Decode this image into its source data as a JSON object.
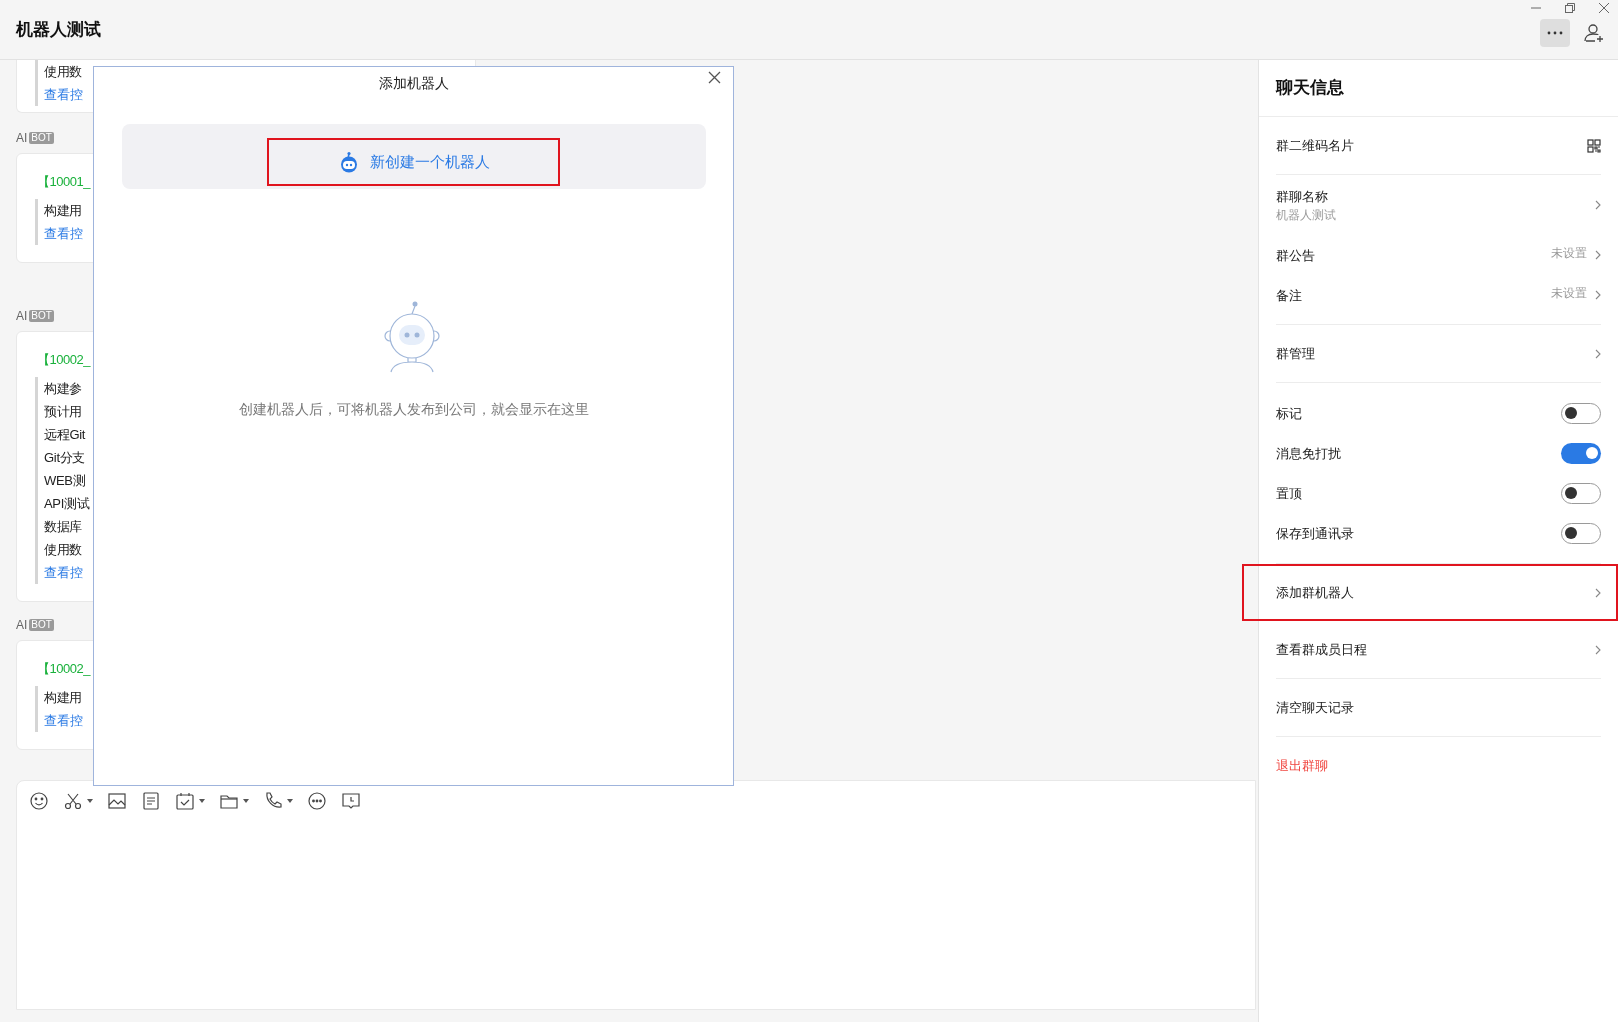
{
  "window": {
    "title": "机器人测试"
  },
  "messages": [
    {
      "lines": [
        "使用数"
      ],
      "link": "查看控"
    },
    {
      "sender": "AI",
      "badge": "BOT",
      "heading": "【10001_",
      "lines": [
        "构建用"
      ],
      "link": "查看控"
    },
    {
      "sender": "AI",
      "badge": "BOT",
      "heading": "【10002_",
      "lines": [
        "构建参",
        "预计用",
        "远程Git",
        "Git分支",
        "WEB测",
        "API测试",
        "数据库",
        "使用数"
      ],
      "link": "查看控"
    },
    {
      "sender": "AI",
      "badge": "BOT",
      "heading": "【10002_",
      "lines": [
        "构建用"
      ],
      "link": "查看控"
    }
  ],
  "toolbar": [
    {
      "kind": "emoji",
      "dropdown": false
    },
    {
      "kind": "scissors",
      "dropdown": true
    },
    {
      "kind": "image",
      "dropdown": false
    },
    {
      "kind": "note",
      "dropdown": false
    },
    {
      "kind": "task",
      "dropdown": true
    },
    {
      "kind": "folder",
      "dropdown": true
    },
    {
      "kind": "phone",
      "dropdown": true
    },
    {
      "kind": "more",
      "dropdown": false
    },
    {
      "kind": "schedule",
      "dropdown": false
    }
  ],
  "dialog": {
    "title": "添加机器人",
    "create_button": {
      "label": "新创建一个机器人",
      "highlighted": true
    },
    "empty_text": "创建机器人后，可将机器人发布到公司，就会显示在这里"
  },
  "panel": {
    "title": "聊天信息",
    "sections": [
      [
        {
          "kind": "qr",
          "label": "群二维码名片",
          "highlighted": false
        }
      ],
      [
        {
          "kind": "link",
          "label": "群聊名称",
          "subtitle": "机器人测试",
          "highlighted": false
        },
        {
          "kind": "link",
          "label": "群公告",
          "value": "未设置",
          "highlighted": false
        },
        {
          "kind": "link",
          "label": "备注",
          "value": "未设置",
          "highlighted": false
        }
      ],
      [
        {
          "kind": "link",
          "label": "群管理",
          "highlighted": false
        }
      ],
      [
        {
          "kind": "toggle",
          "label": "标记",
          "on": false
        },
        {
          "kind": "toggle",
          "label": "消息免打扰",
          "on": true
        },
        {
          "kind": "toggle",
          "label": "置顶",
          "on": false
        },
        {
          "kind": "toggle",
          "label": "保存到通讯录",
          "on": false
        }
      ],
      [
        {
          "kind": "link",
          "label": "添加群机器人",
          "highlighted": true
        },
        {
          "kind": "link",
          "label": "查看群成员日程",
          "highlighted": false
        }
      ],
      [
        {
          "kind": "plain",
          "label": "清空聊天记录",
          "highlighted": false
        }
      ],
      [
        {
          "kind": "danger",
          "label": "退出群聊",
          "highlighted": false
        }
      ]
    ]
  }
}
